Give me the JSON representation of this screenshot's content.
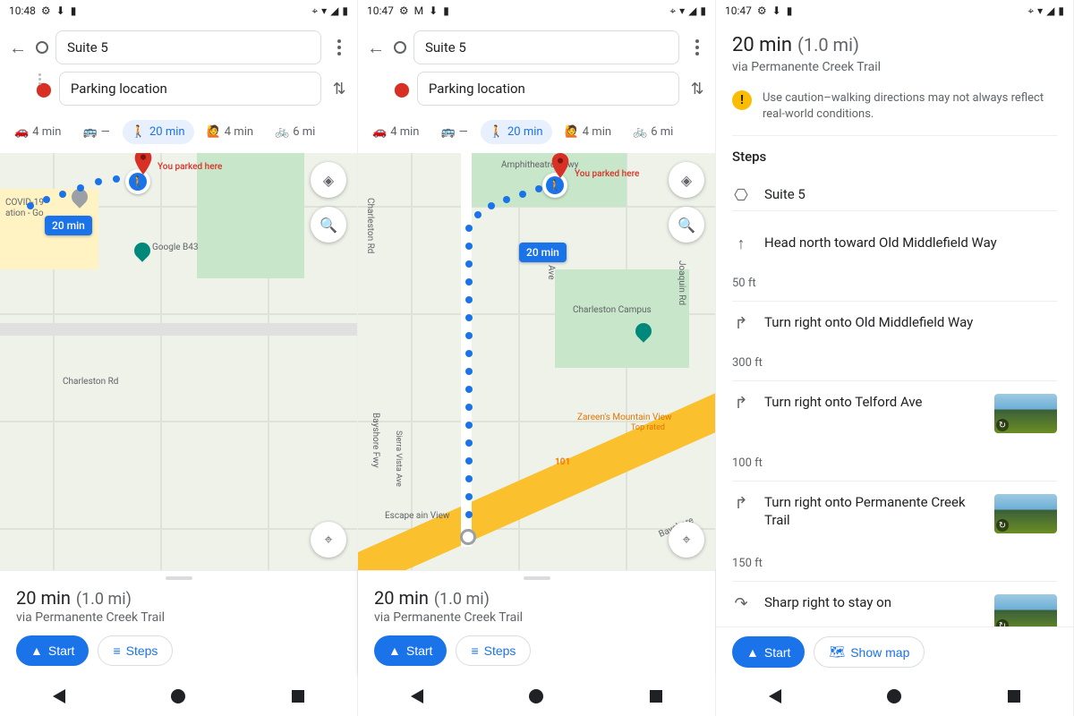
{
  "phone1": {
    "status": {
      "time": "10:48",
      "icons_left": [
        "gear",
        "download",
        "sd"
      ],
      "icons_right": [
        "pin",
        "wifi",
        "signal",
        "battery"
      ]
    },
    "from": "Suite 5",
    "to": "Parking location",
    "modes": {
      "drive": "4 min",
      "transit": "—",
      "walk": "20 min",
      "rideshare": "4 min",
      "cycle": "6 mi"
    },
    "map": {
      "parked_label": "You parked here",
      "route_badge": "20 min",
      "labels": {
        "covid": "COVID-19",
        "covid_sub": "ation - Go",
        "google_b43": "Google B43",
        "charleston": "Charleston Rd"
      }
    },
    "sheet": {
      "duration": "20 min",
      "distance": "(1.0 mi)",
      "via": "via Permanente Creek Trail",
      "start": "Start",
      "steps": "Steps"
    }
  },
  "phone2": {
    "status": {
      "time": "10:47"
    },
    "from": "Suite 5",
    "to": "Parking location",
    "modes": {
      "drive": "4 min",
      "transit": "—",
      "walk": "20 min",
      "rideshare": "4 min",
      "cycle": "6 mi"
    },
    "map": {
      "parked_label": "You parked here",
      "route_badge": "20 min",
      "labels": {
        "amph": "Amphitheatre Pkwy",
        "charleston_rd": "Charleston Rd",
        "alta": "Alta Ave",
        "charleston_campus": "Charleston Campus",
        "bayshore": "Bayshore Fwy",
        "sierra": "Sierra Vista Ave",
        "escape": "Escape ain View",
        "zareen": "Zareen's Mountain View",
        "zareen_sub": "Top rated",
        "joaquin": "Joaquin Rd",
        "hwy101": "101",
        "bayshore2": "Bayshore"
      }
    },
    "sheet": {
      "duration": "20 min",
      "distance": "(1.0 mi)",
      "via": "via Permanente Creek Trail",
      "start": "Start",
      "steps": "Steps"
    }
  },
  "phone3": {
    "status": {
      "time": "10:47"
    },
    "header": {
      "duration": "20 min",
      "distance": "(1.0 mi)",
      "via": "via Permanente Creek Trail"
    },
    "warning": "Use caution–walking directions may not always reflect real-world conditions.",
    "steps_heading": "Steps",
    "start_point": "Suite 5",
    "steps": [
      {
        "icon": "↑",
        "text": "Head north toward Old Middlefield Way",
        "dist": "50 ft",
        "thumb": false
      },
      {
        "icon": "↱",
        "text": "Turn right onto Old Middlefield Way",
        "dist": "300 ft",
        "thumb": false
      },
      {
        "icon": "↱",
        "text": "Turn right onto Telford Ave",
        "dist": "100 ft",
        "thumb": true
      },
      {
        "icon": "↱",
        "text": "Turn right onto Permanente Creek Trail",
        "dist": "150 ft",
        "thumb": true
      },
      {
        "icon": "↷",
        "text": "Sharp right to stay on",
        "dist": "",
        "thumb": true
      }
    ],
    "actions": {
      "start": "Start",
      "showmap": "Show map"
    }
  }
}
